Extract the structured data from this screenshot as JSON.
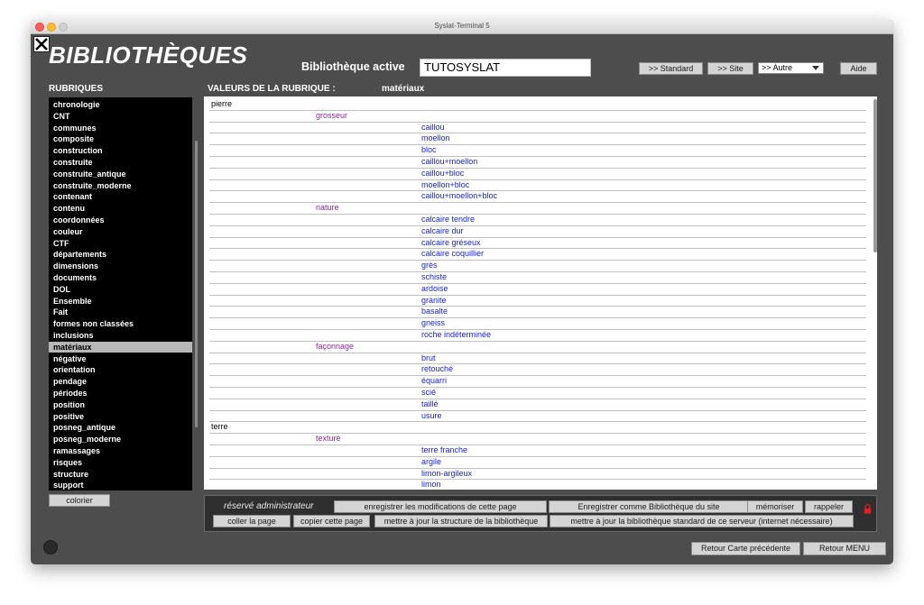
{
  "window": {
    "title": "Syslat-Terminal 5"
  },
  "header": {
    "title": "BIBLIOTHÈQUES",
    "active_label": "Bibliothèque active",
    "active_value": "TUTOSYSLAT",
    "btn_standard": ">> Standard",
    "btn_site": ">> Site",
    "select_value": ">> Autre",
    "btn_aide": "Aide"
  },
  "sidebar": {
    "heading": "RUBRIQUES",
    "items": [
      "chronologie",
      "CNT",
      "communes",
      "composite",
      "construction",
      "construite",
      "construite_antique",
      "construite_moderne",
      "contenant",
      "contenu",
      "coordonnées",
      "couleur",
      "CTF",
      "départements",
      "dimensions",
      "documents",
      "DOL",
      "Ensemble",
      "Fait",
      "formes non classées",
      "inclusions",
      "matériaux",
      "négative",
      "orientation",
      "pendage",
      "périodes",
      "position",
      "positive",
      "posneg_antique",
      "posneg_moderne",
      "ramassages",
      "risques",
      "structure",
      "support"
    ],
    "selected": "matériaux",
    "colorier_label": "colorier"
  },
  "values": {
    "heading": "VALEURS DE LA RUBRIQUE :",
    "rubrique_name": "matériaux",
    "rows": [
      {
        "level": 0,
        "text": "pierre"
      },
      {
        "level": 1,
        "text": "grosseur"
      },
      {
        "level": 2,
        "text": "caillou"
      },
      {
        "level": 2,
        "text": "moellon"
      },
      {
        "level": 2,
        "text": "bloc"
      },
      {
        "level": 2,
        "text": "caillou+moellon"
      },
      {
        "level": 2,
        "text": "caillou+bloc"
      },
      {
        "level": 2,
        "text": "moellon+bloc"
      },
      {
        "level": 2,
        "text": "caillou+moellon+bloc"
      },
      {
        "level": 1,
        "text": "nature"
      },
      {
        "level": 2,
        "text": "calcaire tendre"
      },
      {
        "level": 2,
        "text": "calcaire dur"
      },
      {
        "level": 2,
        "text": "calcaire gréseux"
      },
      {
        "level": 2,
        "text": "calcaire coquillier"
      },
      {
        "level": 2,
        "text": "grès"
      },
      {
        "level": 2,
        "text": "schiste"
      },
      {
        "level": 2,
        "text": "ardoise"
      },
      {
        "level": 2,
        "text": "granite"
      },
      {
        "level": 2,
        "text": "basalte"
      },
      {
        "level": 2,
        "text": "gneiss"
      },
      {
        "level": 2,
        "text": "roche indéterminée"
      },
      {
        "level": 1,
        "text": "façonnage"
      },
      {
        "level": 2,
        "text": "brut"
      },
      {
        "level": 2,
        "text": "retouché"
      },
      {
        "level": 2,
        "text": "équarri"
      },
      {
        "level": 2,
        "text": "scié"
      },
      {
        "level": 2,
        "text": "taillé"
      },
      {
        "level": 2,
        "text": "usure"
      },
      {
        "level": 0,
        "text": "terre"
      },
      {
        "level": 1,
        "text": "texture"
      },
      {
        "level": 2,
        "text": "terre franche"
      },
      {
        "level": 2,
        "text": "argile"
      },
      {
        "level": 2,
        "text": "limon-argileux"
      },
      {
        "level": 2,
        "text": "limon"
      }
    ]
  },
  "admin": {
    "label": "réservé administrateur",
    "btn_save_page": "enregistrer les modifications de cette page",
    "btn_save_site": "Enregistrer comme Bibliothèque du site",
    "btn_memoriser": "mémoriser",
    "btn_rappeler": "rappeler",
    "btn_coller": "coller la page",
    "btn_copier": "copier cette page",
    "btn_update_structure": "mettre à jour la structure de la bibliothèque",
    "btn_update_standard": "mettre à jour la bibliothèque standard de ce serveur (internet nécessaire)"
  },
  "footer": {
    "btn_retour_carte": "Retour Carte précédente",
    "btn_retour_menu": "Retour MENU"
  },
  "colors": {
    "window_bg": "#4d4d4d",
    "level1": "#8b2a9a",
    "level2": "#1a23d6",
    "lock": "#e02020"
  }
}
